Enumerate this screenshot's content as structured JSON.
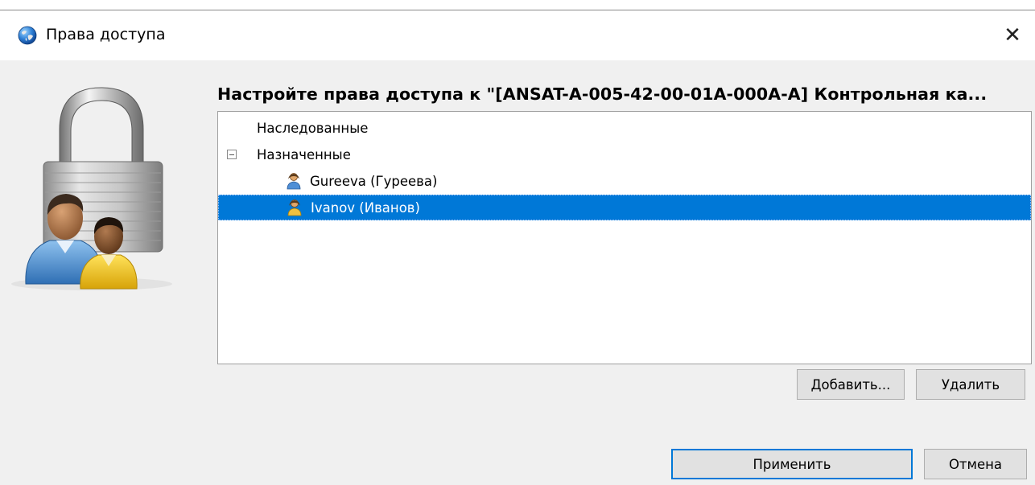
{
  "dialog": {
    "title": "Права доступа",
    "close_symbol": "✕",
    "icons": {
      "title": "globe-icon",
      "hero": "padlock-users-icon"
    }
  },
  "heading": "Настройте права доступа к \"[ANSAT-A-005-42-00-01A-000A-A] Контрольная ка...",
  "tree": {
    "inherited_label": "Наследованные",
    "assigned_label": "Назначенные",
    "users": [
      {
        "label": "Gureeva (Гуреева)",
        "selected": false
      },
      {
        "label": "Ivanov (Иванов)",
        "selected": true
      }
    ]
  },
  "buttons": {
    "add": "Добавить...",
    "remove": "Удалить",
    "apply": "Применить",
    "cancel": "Отмена"
  },
  "colors": {
    "selection": "#0078d7",
    "dialog_bg": "#f0f0f0",
    "button_bg": "#e1e1e1",
    "default_button_border": "#0078d7"
  }
}
